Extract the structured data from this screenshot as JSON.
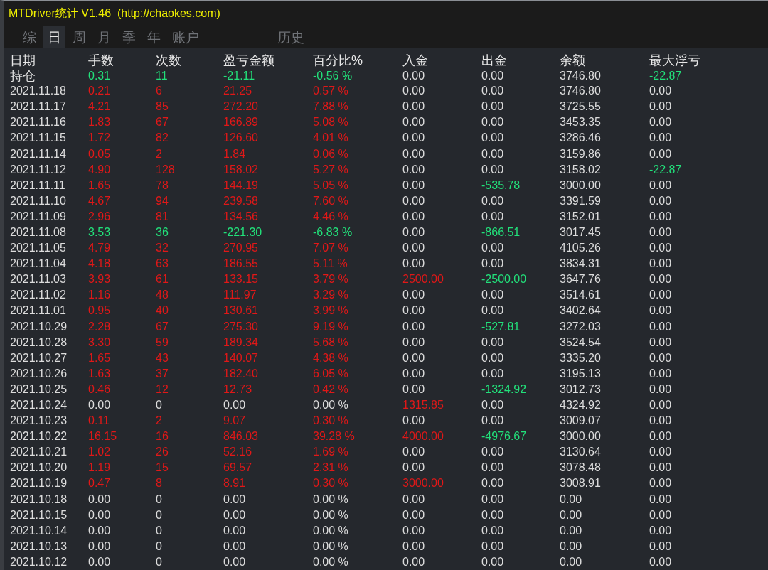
{
  "window": {
    "title": "MTDriver统计 V1.46  (http://chaokes.com)"
  },
  "tabs": [
    {
      "label": "综",
      "selected": false
    },
    {
      "label": "日",
      "selected": true
    },
    {
      "label": "周",
      "selected": false
    },
    {
      "label": "月",
      "selected": false
    },
    {
      "label": "季",
      "selected": false
    },
    {
      "label": "年",
      "selected": false
    },
    {
      "label": "账户",
      "selected": false
    },
    {
      "label": "历史",
      "selected": false
    }
  ],
  "table": {
    "columns": [
      "日期",
      "手数",
      "次数",
      "盈亏金额",
      "百分比%",
      "入金",
      "出金",
      "余额",
      "最大浮亏"
    ],
    "rows": [
      {
        "cells": [
          {
            "text": "持仓",
            "color": "#dcdcdc"
          },
          {
            "text": "0.31",
            "color": "#22e07a"
          },
          {
            "text": "11",
            "color": "#22e07a"
          },
          {
            "text": "-21.11",
            "color": "#22e07a"
          },
          {
            "text": "-0.56 %",
            "color": "#22e07a"
          },
          {
            "text": "0.00",
            "color": "#dcdcdc"
          },
          {
            "text": "0.00",
            "color": "#dcdcdc"
          },
          {
            "text": "3746.80",
            "color": "#dcdcdc"
          },
          {
            "text": "-22.87",
            "color": "#22e07a"
          }
        ]
      },
      {
        "cells": [
          {
            "text": "2021.11.18",
            "color": "#dcdcdc"
          },
          {
            "text": "0.21",
            "color": "#e01818"
          },
          {
            "text": "6",
            "color": "#e01818"
          },
          {
            "text": "21.25",
            "color": "#e01818"
          },
          {
            "text": "0.57 %",
            "color": "#e01818"
          },
          {
            "text": "0.00",
            "color": "#dcdcdc"
          },
          {
            "text": "0.00",
            "color": "#dcdcdc"
          },
          {
            "text": "3746.80",
            "color": "#dcdcdc"
          },
          {
            "text": "0.00",
            "color": "#dcdcdc"
          }
        ]
      },
      {
        "cells": [
          {
            "text": "2021.11.17",
            "color": "#dcdcdc"
          },
          {
            "text": "4.21",
            "color": "#e01818"
          },
          {
            "text": "85",
            "color": "#e01818"
          },
          {
            "text": "272.20",
            "color": "#e01818"
          },
          {
            "text": "7.88 %",
            "color": "#e01818"
          },
          {
            "text": "0.00",
            "color": "#dcdcdc"
          },
          {
            "text": "0.00",
            "color": "#dcdcdc"
          },
          {
            "text": "3725.55",
            "color": "#dcdcdc"
          },
          {
            "text": "0.00",
            "color": "#dcdcdc"
          }
        ]
      },
      {
        "cells": [
          {
            "text": "2021.11.16",
            "color": "#dcdcdc"
          },
          {
            "text": "1.83",
            "color": "#e01818"
          },
          {
            "text": "67",
            "color": "#e01818"
          },
          {
            "text": "166.89",
            "color": "#e01818"
          },
          {
            "text": "5.08 %",
            "color": "#e01818"
          },
          {
            "text": "0.00",
            "color": "#dcdcdc"
          },
          {
            "text": "0.00",
            "color": "#dcdcdc"
          },
          {
            "text": "3453.35",
            "color": "#dcdcdc"
          },
          {
            "text": "0.00",
            "color": "#dcdcdc"
          }
        ]
      },
      {
        "cells": [
          {
            "text": "2021.11.15",
            "color": "#dcdcdc"
          },
          {
            "text": "1.72",
            "color": "#e01818"
          },
          {
            "text": "82",
            "color": "#e01818"
          },
          {
            "text": "126.60",
            "color": "#e01818"
          },
          {
            "text": "4.01 %",
            "color": "#e01818"
          },
          {
            "text": "0.00",
            "color": "#dcdcdc"
          },
          {
            "text": "0.00",
            "color": "#dcdcdc"
          },
          {
            "text": "3286.46",
            "color": "#dcdcdc"
          },
          {
            "text": "0.00",
            "color": "#dcdcdc"
          }
        ]
      },
      {
        "cells": [
          {
            "text": "2021.11.14",
            "color": "#dcdcdc"
          },
          {
            "text": "0.05",
            "color": "#e01818"
          },
          {
            "text": "2",
            "color": "#e01818"
          },
          {
            "text": "1.84",
            "color": "#e01818"
          },
          {
            "text": "0.06 %",
            "color": "#e01818"
          },
          {
            "text": "0.00",
            "color": "#dcdcdc"
          },
          {
            "text": "0.00",
            "color": "#dcdcdc"
          },
          {
            "text": "3159.86",
            "color": "#dcdcdc"
          },
          {
            "text": "0.00",
            "color": "#dcdcdc"
          }
        ]
      },
      {
        "cells": [
          {
            "text": "2021.11.12",
            "color": "#dcdcdc"
          },
          {
            "text": "4.90",
            "color": "#e01818"
          },
          {
            "text": "128",
            "color": "#e01818"
          },
          {
            "text": "158.02",
            "color": "#e01818"
          },
          {
            "text": "5.27 %",
            "color": "#e01818"
          },
          {
            "text": "0.00",
            "color": "#dcdcdc"
          },
          {
            "text": "0.00",
            "color": "#dcdcdc"
          },
          {
            "text": "3158.02",
            "color": "#dcdcdc"
          },
          {
            "text": "-22.87",
            "color": "#22e07a"
          }
        ]
      },
      {
        "cells": [
          {
            "text": "2021.11.11",
            "color": "#dcdcdc"
          },
          {
            "text": "1.65",
            "color": "#e01818"
          },
          {
            "text": "78",
            "color": "#e01818"
          },
          {
            "text": "144.19",
            "color": "#e01818"
          },
          {
            "text": "5.05 %",
            "color": "#e01818"
          },
          {
            "text": "0.00",
            "color": "#dcdcdc"
          },
          {
            "text": "-535.78",
            "color": "#22e07a"
          },
          {
            "text": "3000.00",
            "color": "#dcdcdc"
          },
          {
            "text": "0.00",
            "color": "#dcdcdc"
          }
        ]
      },
      {
        "cells": [
          {
            "text": "2021.11.10",
            "color": "#dcdcdc"
          },
          {
            "text": "4.67",
            "color": "#e01818"
          },
          {
            "text": "94",
            "color": "#e01818"
          },
          {
            "text": "239.58",
            "color": "#e01818"
          },
          {
            "text": "7.60 %",
            "color": "#e01818"
          },
          {
            "text": "0.00",
            "color": "#dcdcdc"
          },
          {
            "text": "0.00",
            "color": "#dcdcdc"
          },
          {
            "text": "3391.59",
            "color": "#dcdcdc"
          },
          {
            "text": "0.00",
            "color": "#dcdcdc"
          }
        ]
      },
      {
        "cells": [
          {
            "text": "2021.11.09",
            "color": "#dcdcdc"
          },
          {
            "text": "2.96",
            "color": "#e01818"
          },
          {
            "text": "81",
            "color": "#e01818"
          },
          {
            "text": "134.56",
            "color": "#e01818"
          },
          {
            "text": "4.46 %",
            "color": "#e01818"
          },
          {
            "text": "0.00",
            "color": "#dcdcdc"
          },
          {
            "text": "0.00",
            "color": "#dcdcdc"
          },
          {
            "text": "3152.01",
            "color": "#dcdcdc"
          },
          {
            "text": "0.00",
            "color": "#dcdcdc"
          }
        ]
      },
      {
        "cells": [
          {
            "text": "2021.11.08",
            "color": "#dcdcdc"
          },
          {
            "text": "3.53",
            "color": "#22e07a"
          },
          {
            "text": "36",
            "color": "#22e07a"
          },
          {
            "text": "-221.30",
            "color": "#22e07a"
          },
          {
            "text": "-6.83 %",
            "color": "#22e07a"
          },
          {
            "text": "0.00",
            "color": "#dcdcdc"
          },
          {
            "text": "-866.51",
            "color": "#22e07a"
          },
          {
            "text": "3017.45",
            "color": "#dcdcdc"
          },
          {
            "text": "0.00",
            "color": "#dcdcdc"
          }
        ]
      },
      {
        "cells": [
          {
            "text": "2021.11.05",
            "color": "#dcdcdc"
          },
          {
            "text": "4.79",
            "color": "#e01818"
          },
          {
            "text": "32",
            "color": "#e01818"
          },
          {
            "text": "270.95",
            "color": "#e01818"
          },
          {
            "text": "7.07 %",
            "color": "#e01818"
          },
          {
            "text": "0.00",
            "color": "#dcdcdc"
          },
          {
            "text": "0.00",
            "color": "#dcdcdc"
          },
          {
            "text": "4105.26",
            "color": "#dcdcdc"
          },
          {
            "text": "0.00",
            "color": "#dcdcdc"
          }
        ]
      },
      {
        "cells": [
          {
            "text": "2021.11.04",
            "color": "#dcdcdc"
          },
          {
            "text": "4.18",
            "color": "#e01818"
          },
          {
            "text": "63",
            "color": "#e01818"
          },
          {
            "text": "186.55",
            "color": "#e01818"
          },
          {
            "text": "5.11 %",
            "color": "#e01818"
          },
          {
            "text": "0.00",
            "color": "#dcdcdc"
          },
          {
            "text": "0.00",
            "color": "#dcdcdc"
          },
          {
            "text": "3834.31",
            "color": "#dcdcdc"
          },
          {
            "text": "0.00",
            "color": "#dcdcdc"
          }
        ]
      },
      {
        "cells": [
          {
            "text": "2021.11.03",
            "color": "#dcdcdc"
          },
          {
            "text": "3.93",
            "color": "#e01818"
          },
          {
            "text": "61",
            "color": "#e01818"
          },
          {
            "text": "133.15",
            "color": "#e01818"
          },
          {
            "text": "3.79 %",
            "color": "#e01818"
          },
          {
            "text": "2500.00",
            "color": "#e01818"
          },
          {
            "text": "-2500.00",
            "color": "#22e07a"
          },
          {
            "text": "3647.76",
            "color": "#dcdcdc"
          },
          {
            "text": "0.00",
            "color": "#dcdcdc"
          }
        ]
      },
      {
        "cells": [
          {
            "text": "2021.11.02",
            "color": "#dcdcdc"
          },
          {
            "text": "1.16",
            "color": "#e01818"
          },
          {
            "text": "48",
            "color": "#e01818"
          },
          {
            "text": "111.97",
            "color": "#e01818"
          },
          {
            "text": "3.29 %",
            "color": "#e01818"
          },
          {
            "text": "0.00",
            "color": "#dcdcdc"
          },
          {
            "text": "0.00",
            "color": "#dcdcdc"
          },
          {
            "text": "3514.61",
            "color": "#dcdcdc"
          },
          {
            "text": "0.00",
            "color": "#dcdcdc"
          }
        ]
      },
      {
        "cells": [
          {
            "text": "2021.11.01",
            "color": "#dcdcdc"
          },
          {
            "text": "0.95",
            "color": "#e01818"
          },
          {
            "text": "40",
            "color": "#e01818"
          },
          {
            "text": "130.61",
            "color": "#e01818"
          },
          {
            "text": "3.99 %",
            "color": "#e01818"
          },
          {
            "text": "0.00",
            "color": "#dcdcdc"
          },
          {
            "text": "0.00",
            "color": "#dcdcdc"
          },
          {
            "text": "3402.64",
            "color": "#dcdcdc"
          },
          {
            "text": "0.00",
            "color": "#dcdcdc"
          }
        ]
      },
      {
        "cells": [
          {
            "text": "2021.10.29",
            "color": "#dcdcdc"
          },
          {
            "text": "2.28",
            "color": "#e01818"
          },
          {
            "text": "67",
            "color": "#e01818"
          },
          {
            "text": "275.30",
            "color": "#e01818"
          },
          {
            "text": "9.19 %",
            "color": "#e01818"
          },
          {
            "text": "0.00",
            "color": "#dcdcdc"
          },
          {
            "text": "-527.81",
            "color": "#22e07a"
          },
          {
            "text": "3272.03",
            "color": "#dcdcdc"
          },
          {
            "text": "0.00",
            "color": "#dcdcdc"
          }
        ]
      },
      {
        "cells": [
          {
            "text": "2021.10.28",
            "color": "#dcdcdc"
          },
          {
            "text": "3.30",
            "color": "#e01818"
          },
          {
            "text": "59",
            "color": "#e01818"
          },
          {
            "text": "189.34",
            "color": "#e01818"
          },
          {
            "text": "5.68 %",
            "color": "#e01818"
          },
          {
            "text": "0.00",
            "color": "#dcdcdc"
          },
          {
            "text": "0.00",
            "color": "#dcdcdc"
          },
          {
            "text": "3524.54",
            "color": "#dcdcdc"
          },
          {
            "text": "0.00",
            "color": "#dcdcdc"
          }
        ]
      },
      {
        "cells": [
          {
            "text": "2021.10.27",
            "color": "#dcdcdc"
          },
          {
            "text": "1.65",
            "color": "#e01818"
          },
          {
            "text": "43",
            "color": "#e01818"
          },
          {
            "text": "140.07",
            "color": "#e01818"
          },
          {
            "text": "4.38 %",
            "color": "#e01818"
          },
          {
            "text": "0.00",
            "color": "#dcdcdc"
          },
          {
            "text": "0.00",
            "color": "#dcdcdc"
          },
          {
            "text": "3335.20",
            "color": "#dcdcdc"
          },
          {
            "text": "0.00",
            "color": "#dcdcdc"
          }
        ]
      },
      {
        "cells": [
          {
            "text": "2021.10.26",
            "color": "#dcdcdc"
          },
          {
            "text": "1.63",
            "color": "#e01818"
          },
          {
            "text": "37",
            "color": "#e01818"
          },
          {
            "text": "182.40",
            "color": "#e01818"
          },
          {
            "text": "6.05 %",
            "color": "#e01818"
          },
          {
            "text": "0.00",
            "color": "#dcdcdc"
          },
          {
            "text": "0.00",
            "color": "#dcdcdc"
          },
          {
            "text": "3195.13",
            "color": "#dcdcdc"
          },
          {
            "text": "0.00",
            "color": "#dcdcdc"
          }
        ]
      },
      {
        "cells": [
          {
            "text": "2021.10.25",
            "color": "#dcdcdc"
          },
          {
            "text": "0.46",
            "color": "#e01818"
          },
          {
            "text": "12",
            "color": "#e01818"
          },
          {
            "text": "12.73",
            "color": "#e01818"
          },
          {
            "text": "0.42 %",
            "color": "#e01818"
          },
          {
            "text": "0.00",
            "color": "#dcdcdc"
          },
          {
            "text": "-1324.92",
            "color": "#22e07a"
          },
          {
            "text": "3012.73",
            "color": "#dcdcdc"
          },
          {
            "text": "0.00",
            "color": "#dcdcdc"
          }
        ]
      },
      {
        "cells": [
          {
            "text": "2021.10.24",
            "color": "#dcdcdc"
          },
          {
            "text": "0.00",
            "color": "#dcdcdc"
          },
          {
            "text": "0",
            "color": "#dcdcdc"
          },
          {
            "text": "0.00",
            "color": "#dcdcdc"
          },
          {
            "text": "0.00 %",
            "color": "#dcdcdc"
          },
          {
            "text": "1315.85",
            "color": "#e01818"
          },
          {
            "text": "0.00",
            "color": "#dcdcdc"
          },
          {
            "text": "4324.92",
            "color": "#dcdcdc"
          },
          {
            "text": "0.00",
            "color": "#dcdcdc"
          }
        ]
      },
      {
        "cells": [
          {
            "text": "2021.10.23",
            "color": "#dcdcdc"
          },
          {
            "text": "0.11",
            "color": "#e01818"
          },
          {
            "text": "2",
            "color": "#e01818"
          },
          {
            "text": "9.07",
            "color": "#e01818"
          },
          {
            "text": "0.30 %",
            "color": "#e01818"
          },
          {
            "text": "0.00",
            "color": "#dcdcdc"
          },
          {
            "text": "0.00",
            "color": "#dcdcdc"
          },
          {
            "text": "3009.07",
            "color": "#dcdcdc"
          },
          {
            "text": "0.00",
            "color": "#dcdcdc"
          }
        ]
      },
      {
        "cells": [
          {
            "text": "2021.10.22",
            "color": "#dcdcdc"
          },
          {
            "text": "16.15",
            "color": "#e01818"
          },
          {
            "text": "16",
            "color": "#e01818"
          },
          {
            "text": "846.03",
            "color": "#e01818"
          },
          {
            "text": "39.28 %",
            "color": "#e01818"
          },
          {
            "text": "4000.00",
            "color": "#e01818"
          },
          {
            "text": "-4976.67",
            "color": "#22e07a"
          },
          {
            "text": "3000.00",
            "color": "#dcdcdc"
          },
          {
            "text": "0.00",
            "color": "#dcdcdc"
          }
        ]
      },
      {
        "cells": [
          {
            "text": "2021.10.21",
            "color": "#dcdcdc"
          },
          {
            "text": "1.02",
            "color": "#e01818"
          },
          {
            "text": "26",
            "color": "#e01818"
          },
          {
            "text": "52.16",
            "color": "#e01818"
          },
          {
            "text": "1.69 %",
            "color": "#e01818"
          },
          {
            "text": "0.00",
            "color": "#dcdcdc"
          },
          {
            "text": "0.00",
            "color": "#dcdcdc"
          },
          {
            "text": "3130.64",
            "color": "#dcdcdc"
          },
          {
            "text": "0.00",
            "color": "#dcdcdc"
          }
        ]
      },
      {
        "cells": [
          {
            "text": "2021.10.20",
            "color": "#dcdcdc"
          },
          {
            "text": "1.19",
            "color": "#e01818"
          },
          {
            "text": "15",
            "color": "#e01818"
          },
          {
            "text": "69.57",
            "color": "#e01818"
          },
          {
            "text": "2.31 %",
            "color": "#e01818"
          },
          {
            "text": "0.00",
            "color": "#dcdcdc"
          },
          {
            "text": "0.00",
            "color": "#dcdcdc"
          },
          {
            "text": "3078.48",
            "color": "#dcdcdc"
          },
          {
            "text": "0.00",
            "color": "#dcdcdc"
          }
        ]
      },
      {
        "cells": [
          {
            "text": "2021.10.19",
            "color": "#dcdcdc"
          },
          {
            "text": "0.47",
            "color": "#e01818"
          },
          {
            "text": "8",
            "color": "#e01818"
          },
          {
            "text": "8.91",
            "color": "#e01818"
          },
          {
            "text": "0.30 %",
            "color": "#e01818"
          },
          {
            "text": "3000.00",
            "color": "#e01818"
          },
          {
            "text": "0.00",
            "color": "#dcdcdc"
          },
          {
            "text": "3008.91",
            "color": "#dcdcdc"
          },
          {
            "text": "0.00",
            "color": "#dcdcdc"
          }
        ]
      },
      {
        "cells": [
          {
            "text": "2021.10.18",
            "color": "#dcdcdc"
          },
          {
            "text": "0.00",
            "color": "#dcdcdc"
          },
          {
            "text": "0",
            "color": "#dcdcdc"
          },
          {
            "text": "0.00",
            "color": "#dcdcdc"
          },
          {
            "text": "0.00 %",
            "color": "#dcdcdc"
          },
          {
            "text": "0.00",
            "color": "#dcdcdc"
          },
          {
            "text": "0.00",
            "color": "#dcdcdc"
          },
          {
            "text": "0.00",
            "color": "#dcdcdc"
          },
          {
            "text": "0.00",
            "color": "#dcdcdc"
          }
        ]
      },
      {
        "cells": [
          {
            "text": "2021.10.15",
            "color": "#dcdcdc"
          },
          {
            "text": "0.00",
            "color": "#dcdcdc"
          },
          {
            "text": "0",
            "color": "#dcdcdc"
          },
          {
            "text": "0.00",
            "color": "#dcdcdc"
          },
          {
            "text": "0.00 %",
            "color": "#dcdcdc"
          },
          {
            "text": "0.00",
            "color": "#dcdcdc"
          },
          {
            "text": "0.00",
            "color": "#dcdcdc"
          },
          {
            "text": "0.00",
            "color": "#dcdcdc"
          },
          {
            "text": "0.00",
            "color": "#dcdcdc"
          }
        ]
      },
      {
        "cells": [
          {
            "text": "2021.10.14",
            "color": "#dcdcdc"
          },
          {
            "text": "0.00",
            "color": "#dcdcdc"
          },
          {
            "text": "0",
            "color": "#dcdcdc"
          },
          {
            "text": "0.00",
            "color": "#dcdcdc"
          },
          {
            "text": "0.00 %",
            "color": "#dcdcdc"
          },
          {
            "text": "0.00",
            "color": "#dcdcdc"
          },
          {
            "text": "0.00",
            "color": "#dcdcdc"
          },
          {
            "text": "0.00",
            "color": "#dcdcdc"
          },
          {
            "text": "0.00",
            "color": "#dcdcdc"
          }
        ]
      },
      {
        "cells": [
          {
            "text": "2021.10.13",
            "color": "#dcdcdc"
          },
          {
            "text": "0.00",
            "color": "#dcdcdc"
          },
          {
            "text": "0",
            "color": "#dcdcdc"
          },
          {
            "text": "0.00",
            "color": "#dcdcdc"
          },
          {
            "text": "0.00 %",
            "color": "#dcdcdc"
          },
          {
            "text": "0.00",
            "color": "#dcdcdc"
          },
          {
            "text": "0.00",
            "color": "#dcdcdc"
          },
          {
            "text": "0.00",
            "color": "#dcdcdc"
          },
          {
            "text": "0.00",
            "color": "#dcdcdc"
          }
        ]
      },
      {
        "cells": [
          {
            "text": "2021.10.12",
            "color": "#dcdcdc"
          },
          {
            "text": "0.00",
            "color": "#dcdcdc"
          },
          {
            "text": "0",
            "color": "#dcdcdc"
          },
          {
            "text": "0.00",
            "color": "#dcdcdc"
          },
          {
            "text": "0.00 %",
            "color": "#dcdcdc"
          },
          {
            "text": "0.00",
            "color": "#dcdcdc"
          },
          {
            "text": "0.00",
            "color": "#dcdcdc"
          },
          {
            "text": "0.00",
            "color": "#dcdcdc"
          },
          {
            "text": "0.00",
            "color": "#dcdcdc"
          }
        ]
      }
    ]
  }
}
